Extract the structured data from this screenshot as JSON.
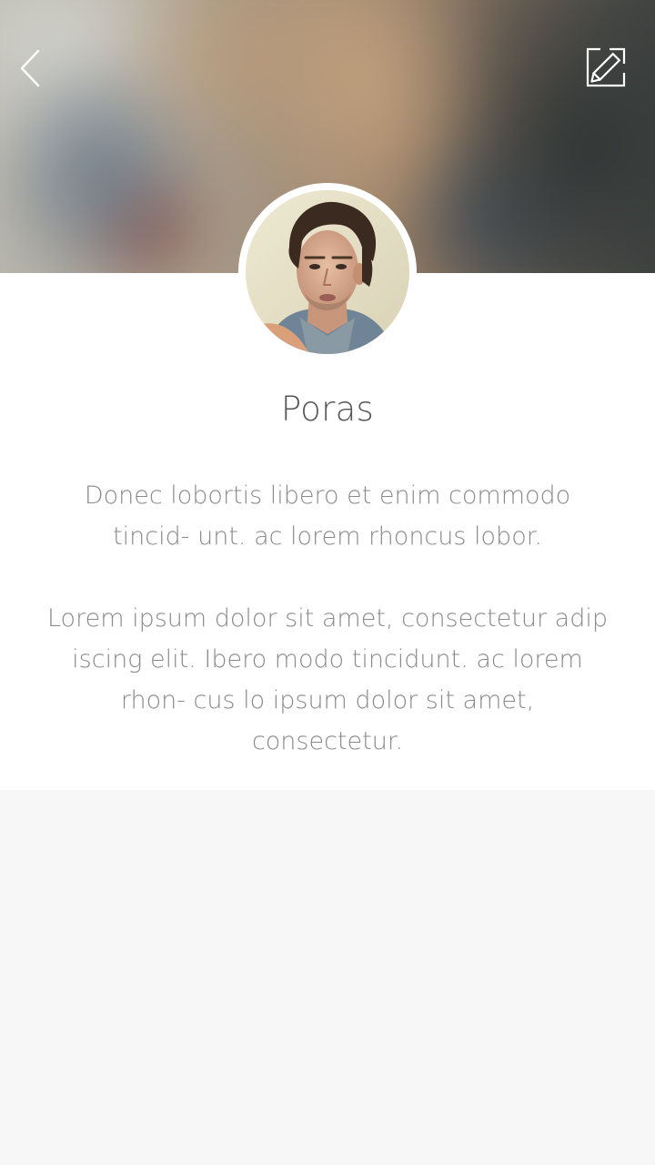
{
  "header": {
    "back_icon": "chevron-left-icon",
    "edit_icon": "edit-pencil-icon"
  },
  "profile": {
    "name": "Poras",
    "bio_paragraph_1": "Donec lobortis libero et enim commodo tincid- unt.  ac lorem rhoncus lobor.",
    "bio_paragraph_2": "Lorem ipsum dolor sit amet, consectetur adip iscing elit. Ibero modo tincidunt.  ac lorem rhon- cus lo ipsum dolor sit amet, consectetur."
  },
  "colors": {
    "name_text": "#555555",
    "body_text": "#8a8a8a",
    "footer_background": "#f7f7f7",
    "background": "#ffffff"
  }
}
